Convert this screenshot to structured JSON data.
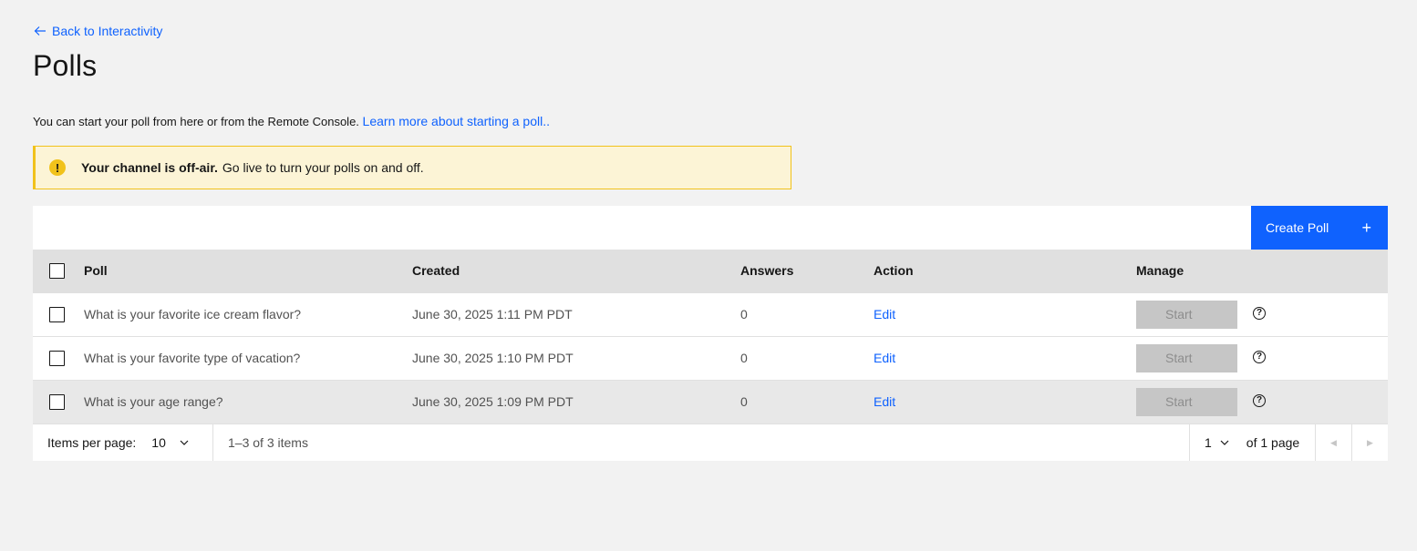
{
  "nav": {
    "back_label": "Back to Interactivity"
  },
  "page": {
    "title": "Polls"
  },
  "intro": {
    "text": "You can start your poll from here or from the Remote Console.",
    "link": "Learn more about starting a poll.."
  },
  "notice": {
    "title": "Your channel is off-air.",
    "message": "Go live to turn your polls on and off.",
    "icon": "warning-icon"
  },
  "toolbar": {
    "create_label": "Create Poll",
    "create_icon": "+"
  },
  "table": {
    "headers": {
      "poll": "Poll",
      "created": "Created",
      "answers": "Answers",
      "action": "Action",
      "manage": "Manage"
    },
    "rows": [
      {
        "poll": "What is your favorite ice cream flavor?",
        "created": "June 30, 2025 1:11 PM PDT",
        "answers": "0",
        "action": "Edit",
        "manage": "Start"
      },
      {
        "poll": "What is your favorite type of vacation?",
        "created": "June 30, 2025 1:10 PM PDT",
        "answers": "0",
        "action": "Edit",
        "manage": "Start"
      },
      {
        "poll": "What is your age range?",
        "created": "June 30, 2025 1:09 PM PDT",
        "answers": "0",
        "action": "Edit",
        "manage": "Start"
      }
    ]
  },
  "pagination": {
    "items_per_page_label": "Items per page:",
    "items_per_page": "10",
    "range": "1–3 of 3 items",
    "page": "1",
    "of_pages": "of 1 page"
  },
  "colors": {
    "primary": "#0f62fe",
    "warning": "#f1c21b",
    "warning_bg": "#fcf4d6"
  }
}
